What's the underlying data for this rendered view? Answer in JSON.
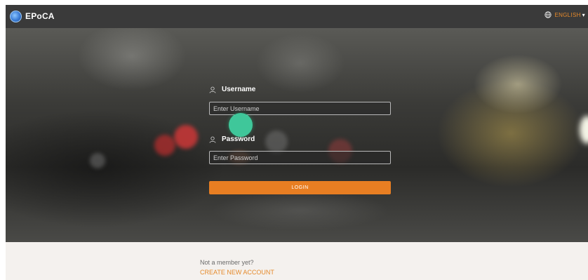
{
  "header": {
    "app_name": "EPoCA",
    "language": {
      "label": "ENGLISH",
      "icon": "globe-icon",
      "caret": "▾"
    }
  },
  "login_form": {
    "username": {
      "label": "Username",
      "placeholder": "Enter Username",
      "value": "",
      "icon": "user-icon"
    },
    "password": {
      "label": "Password",
      "placeholder": "Enter Password",
      "value": "",
      "icon": "user-icon"
    },
    "login_label": "LOGIN"
  },
  "footer": {
    "prompt": "Not a member yet?",
    "create_account_label": "CREATE NEW ACCOUNT"
  },
  "colors": {
    "accent": "#e87e22",
    "link": "#e58a2b",
    "header_bg": "#3a3a3a",
    "cursor_indicator": "#3fc79a"
  }
}
